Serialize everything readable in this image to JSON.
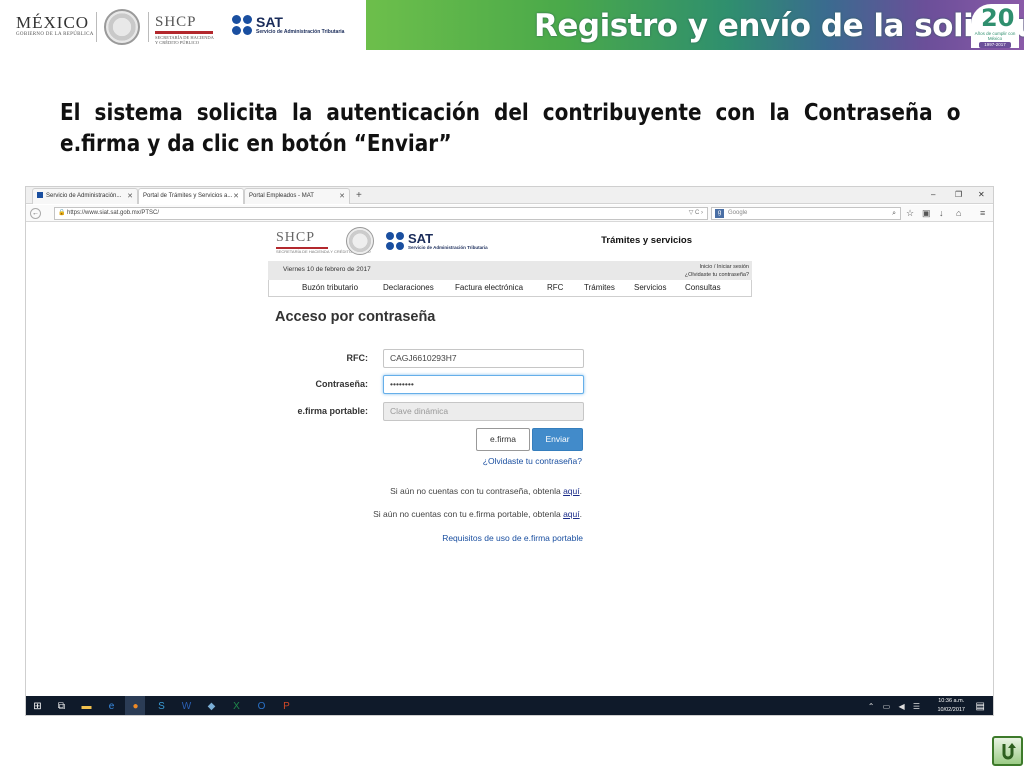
{
  "brand": {
    "mexico_word": "MÉXICO",
    "mexico_sub": "GOBIERNO DE LA REPÚBLICA",
    "shcp_word": "SHCP",
    "shcp_sub_1": "SECRETARÍA DE HACIENDA",
    "shcp_sub_2": "Y CRÉDITO PÚBLICO",
    "sat_word": "SAT",
    "sat_sub": "Servicio de Administración Tributaria",
    "banner_title": "Registro y envío de la solicitud",
    "anniv_num": "20",
    "anniv_sub": "Años de cumplir con México",
    "anniv_years": "1997-2017",
    "colors": {
      "banner_start": "#6dbf4b",
      "banner_end": "#8a5aa8",
      "sat_blue": "#1a4fa0"
    }
  },
  "heading": "El sistema solicita la autenticación del contribuyente con la Contraseña o e.firma y da clic en botón “Enviar”",
  "browser": {
    "tabs": [
      {
        "label": "Servicio de Administración..."
      },
      {
        "label": "Portal de Trámites y Servicios a..."
      },
      {
        "label": "Portal Empleados - MAT"
      }
    ],
    "new_tab": "+",
    "window_controls": {
      "minimize": "–",
      "restore": "❐",
      "close": "✕"
    },
    "url": "https://www.siat.sat.gob.mx/PTSC/",
    "search_placeholder": "Google"
  },
  "site": {
    "shcp_word": "SHCP",
    "shcp_sub": "SECRETARÍA DE HACIENDA Y CRÉDITO PÚBLICO",
    "sat_word": "SAT",
    "sat_sub": "Servicio de Administración Tributaria",
    "tagline": "Trámites y servicios",
    "date": "Viernes 10 de febrero de 2017",
    "session_1": "Inicio / Iniciar sesión",
    "session_2": "¿Olvidaste tu contraseña?",
    "menu": [
      "Buzón tributario",
      "Declaraciones",
      "Factura electrónica",
      "RFC",
      "Trámites",
      "Servicios",
      "Consultas"
    ]
  },
  "login": {
    "title": "Acceso por contraseña",
    "rfc_label": "RFC:",
    "rfc_value": "CAGJ6610293H7",
    "password_label": "Contraseña:",
    "password_value": "••••••••",
    "efirma_label": "e.firma portable:",
    "efirma_placeholder": "Clave dinámica",
    "efirma_button": "e.firma",
    "submit_button": "Enviar",
    "forgot_link": "¿Olvidaste tu contraseña?",
    "info_1_text": "Si aún no cuentas con tu contraseña, obtenla ",
    "info_1_link": "aquí",
    "info_2_text": "Si aún no cuentas con tu e.firma portable, obtenla ",
    "info_2_link": "aquí",
    "requirements_link": "Requisitos de uso de e.firma portable"
  },
  "taskbar": {
    "tray": "⌃ ▭ ◀ ☰",
    "time": "10:36 a.m.",
    "date": "10/02/2017"
  }
}
